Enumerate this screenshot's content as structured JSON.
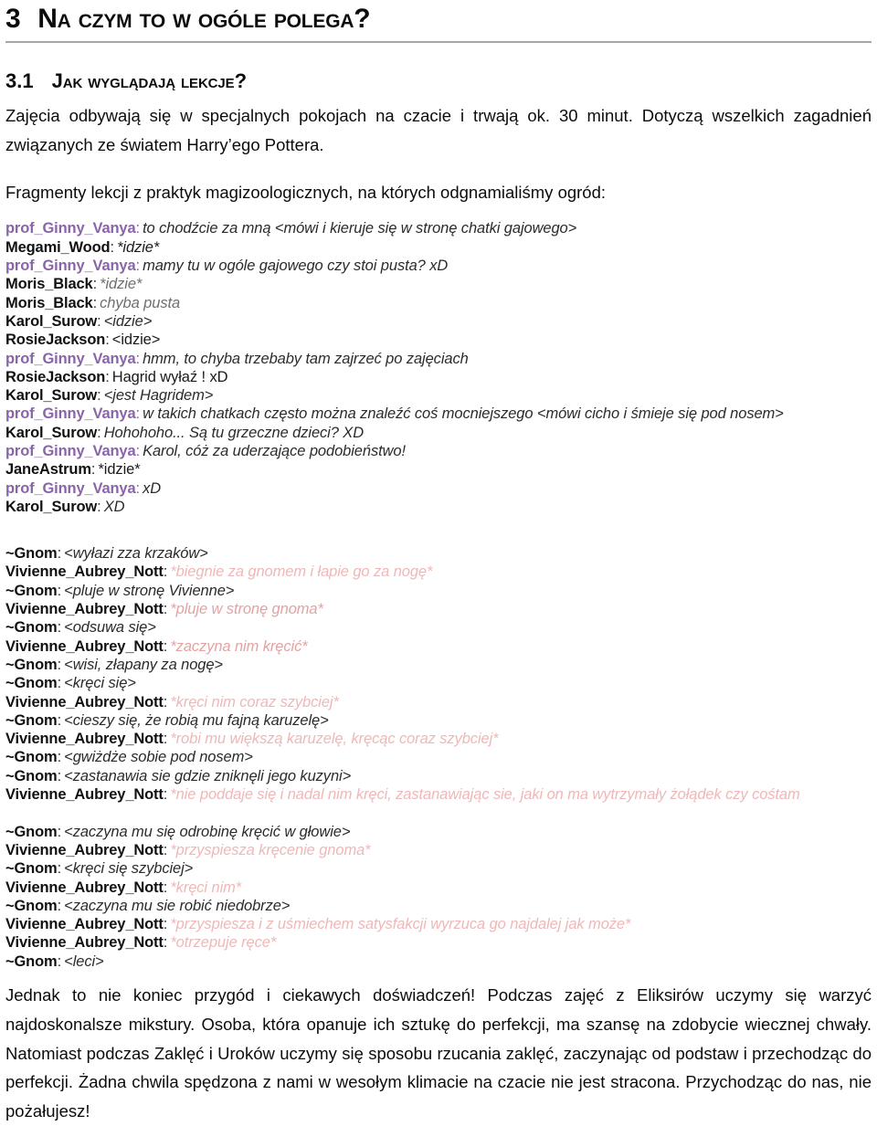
{
  "document": {
    "heading1": {
      "number": "3",
      "text": "Na czym to w ogóle polega?"
    },
    "heading2": {
      "number": "3.1",
      "text": "Jak wyglądają lekcje?"
    },
    "paragraph_intro_1": "Zajęcia odbywają się w specjalnych pokojach na czacie i trwają ok. 30 minut. Dotyczą wszelkich zagadnień związanych ze światem Harry’ego Pottera.",
    "paragraph_intro_2": "Fragmenty lekcji z praktyk magizoologicznych, na których odgnamialiśmy ogród:",
    "paragraph_closing": "Jednak to nie koniec przygód i ciekawych doświadczeń! Podczas zajęć z Eliksirów uczymy się warzyć najdoskonalsze mikstury. Osoba, która opanuje ich sztukę do perfekcji, ma szansę na zdobycie wiecznej chwały. Natomiast podczas Zaklęć i Uroków uczymy się sposobu rzucania zaklęć, zaczynając od podstaw i przechodząc do perfekcji. Żadna chwila spędzona z nami w wesołym klimacie na czacie nie jest stracona. Przychodząc do nas, nie pożałujesz!"
  },
  "colors": {
    "professor_nick": "#8a64ab",
    "default_nick": "#111111",
    "pink_message": "#e3a3a3",
    "grey_message": "#6f6f6f",
    "heading_rule": "#a6a6a6"
  },
  "chatlog": {
    "blocks": [
      {
        "id": "lesson-magizoology-hut",
        "lines": [
          {
            "nick": "prof_Ginny_Vanya",
            "nick_color": "purple",
            "msg": "to chodźcie za mną <mówi i kieruje się w stronę chatki gajowego>",
            "msg_color": "darkgrey",
            "italic": true
          },
          {
            "nick": "Megami_Wood",
            "nick_color": "dark",
            "msg": "*idzie*",
            "msg_color": "black",
            "italic": true
          },
          {
            "nick": "prof_Ginny_Vanya",
            "nick_color": "purple",
            "msg": "mamy tu w ogóle gajowego czy stoi pusta? xD",
            "msg_color": "darkgrey",
            "italic": true
          },
          {
            "nick": "Moris_Black",
            "nick_color": "dark",
            "msg": "*idzie*",
            "msg_color": "grey",
            "italic": true
          },
          {
            "nick": "Moris_Black",
            "nick_color": "dark",
            "msg": "chyba pusta",
            "msg_color": "grey",
            "italic": true
          },
          {
            "nick": "Karol_Surow",
            "nick_color": "dark",
            "msg": "<idzie>",
            "msg_color": "darkgrey",
            "italic": true
          },
          {
            "nick": "RosieJackson",
            "nick_color": "dark",
            "msg": "<idzie>",
            "msg_color": "black",
            "italic": false
          },
          {
            "nick": "prof_Ginny_Vanya",
            "nick_color": "purple",
            "msg": "hmm, to chyba trzebaby tam zajrzeć po zajęciach",
            "msg_color": "darkgrey",
            "italic": true
          },
          {
            "nick": "RosieJackson",
            "nick_color": "dark",
            "msg": "Hagrid wyłaź ! xD",
            "msg_color": "black",
            "italic": false
          },
          {
            "nick": "Karol_Surow",
            "nick_color": "dark",
            "msg": "<jest Hagridem>",
            "msg_color": "darkgrey",
            "italic": true
          },
          {
            "nick": "prof_Ginny_Vanya",
            "nick_color": "purple",
            "msg": "w takich chatkach często można znaleźć coś mocniejszego <mówi cicho i śmieje się pod nosem>",
            "msg_color": "darkgrey",
            "italic": true
          },
          {
            "nick": "Karol_Surow",
            "nick_color": "dark",
            "msg": "Hohohoho... Są tu grzeczne dzieci? XD",
            "msg_color": "darkgrey",
            "italic": true
          },
          {
            "nick": "prof_Ginny_Vanya",
            "nick_color": "purple",
            "msg": "Karol, cóż za uderzające podobieństwo!",
            "msg_color": "darkgrey",
            "italic": true
          },
          {
            "nick": "JaneAstrum",
            "nick_color": "dark",
            "msg": "*idzie*",
            "msg_color": "black",
            "italic": false
          },
          {
            "nick": "prof_Ginny_Vanya",
            "nick_color": "purple",
            "msg": "xD",
            "msg_color": "darkgrey",
            "italic": true
          },
          {
            "nick": "Karol_Surow",
            "nick_color": "dark",
            "msg": "XD",
            "msg_color": "darkgrey",
            "italic": true
          }
        ]
      },
      {
        "id": "gnome-degnoming",
        "lines": [
          {
            "nick": "~Gnom",
            "nick_color": "dark",
            "msg": "<wyłazi zza krzaków>",
            "msg_color": "darkgrey",
            "italic": true
          },
          {
            "nick": "Vivienne_Aubrey_Nott",
            "nick_color": "dark",
            "msg": "*biegnie za gnomem i łapie go za nogę*",
            "msg_color": "pink",
            "italic": true
          },
          {
            "nick": "~Gnom",
            "nick_color": "dark",
            "msg": "<pluje w stronę Vivienne>",
            "msg_color": "darkgrey",
            "italic": true
          },
          {
            "nick": "Vivienne_Aubrey_Nott",
            "nick_color": "dark",
            "msg": "*pluje w stronę gnoma*",
            "msg_color": "pinkish",
            "italic": true
          },
          {
            "nick": "~Gnom",
            "nick_color": "dark",
            "msg": "<odsuwa się>",
            "msg_color": "darkgrey",
            "italic": true
          },
          {
            "nick": "Vivienne_Aubrey_Nott",
            "nick_color": "dark",
            "msg": "*zaczyna nim kręcić*",
            "msg_color": "pinkish",
            "italic": true
          },
          {
            "nick": "~Gnom",
            "nick_color": "dark",
            "msg": "<wisi, złapany za nogę>",
            "msg_color": "darkgrey",
            "italic": true
          },
          {
            "nick": "~Gnom",
            "nick_color": "dark",
            "msg": "<kręci się>",
            "msg_color": "darkgrey",
            "italic": true
          },
          {
            "nick": "Vivienne_Aubrey_Nott",
            "nick_color": "dark",
            "msg": "*kręci nim coraz szybciej*",
            "msg_color": "pink",
            "italic": true
          },
          {
            "nick": "~Gnom",
            "nick_color": "dark",
            "msg": "<cieszy się, że robią mu fajną karuzelę>",
            "msg_color": "darkgrey",
            "italic": true
          },
          {
            "nick": "Vivienne_Aubrey_Nott",
            "nick_color": "dark",
            "msg": "*robi mu większą karuzelę, kręcąc coraz szybciej*",
            "msg_color": "pink",
            "italic": true
          },
          {
            "nick": "~Gnom",
            "nick_color": "dark",
            "msg": "<gwiżdże sobie pod nosem>",
            "msg_color": "darkgrey",
            "italic": true
          },
          {
            "nick": "~Gnom",
            "nick_color": "dark",
            "msg": "<zastanawia sie gdzie zniknęli jego kuzyni>",
            "msg_color": "darkgrey",
            "italic": true
          },
          {
            "nick": "Vivienne_Aubrey_Nott",
            "nick_color": "dark",
            "msg": "*nie poddaje się i nadal nim kręci, zastanawiając sie, jaki on ma wytrzymały żołądek czy cośtam",
            "msg_color": "pink",
            "italic": true
          },
          {
            "nick": "",
            "nick_color": "dark",
            "msg": "",
            "msg_color": "black",
            "italic": false
          },
          {
            "nick": "~Gnom",
            "nick_color": "dark",
            "msg": "<zaczyna mu się odrobinę kręcić w głowie>",
            "msg_color": "darkgrey",
            "italic": true
          },
          {
            "nick": "Vivienne_Aubrey_Nott",
            "nick_color": "dark",
            "msg": "*przyspiesza kręcenie gnoma*",
            "msg_color": "pink",
            "italic": true
          },
          {
            "nick": "~Gnom",
            "nick_color": "dark",
            "msg": "<kręci się szybciej>",
            "msg_color": "darkgrey",
            "italic": true
          },
          {
            "nick": "Vivienne_Aubrey_Nott",
            "nick_color": "dark",
            "msg": "*kręci nim*",
            "msg_color": "pink",
            "italic": true
          },
          {
            "nick": "~Gnom",
            "nick_color": "dark",
            "msg": "<zaczyna mu sie robić niedobrze>",
            "msg_color": "darkgrey",
            "italic": true
          },
          {
            "nick": "Vivienne_Aubrey_Nott",
            "nick_color": "dark",
            "msg": "*przyspiesza i z uśmiechem satysfakcji wyrzuca go najdalej jak może*",
            "msg_color": "pink",
            "italic": true
          },
          {
            "nick": "Vivienne_Aubrey_Nott",
            "nick_color": "dark",
            "msg": "*otrzepuje ręce*",
            "msg_color": "pink",
            "italic": true
          },
          {
            "nick": "~Gnom",
            "nick_color": "dark",
            "msg": "<leci>",
            "msg_color": "darkgrey",
            "italic": true
          }
        ]
      }
    ]
  }
}
